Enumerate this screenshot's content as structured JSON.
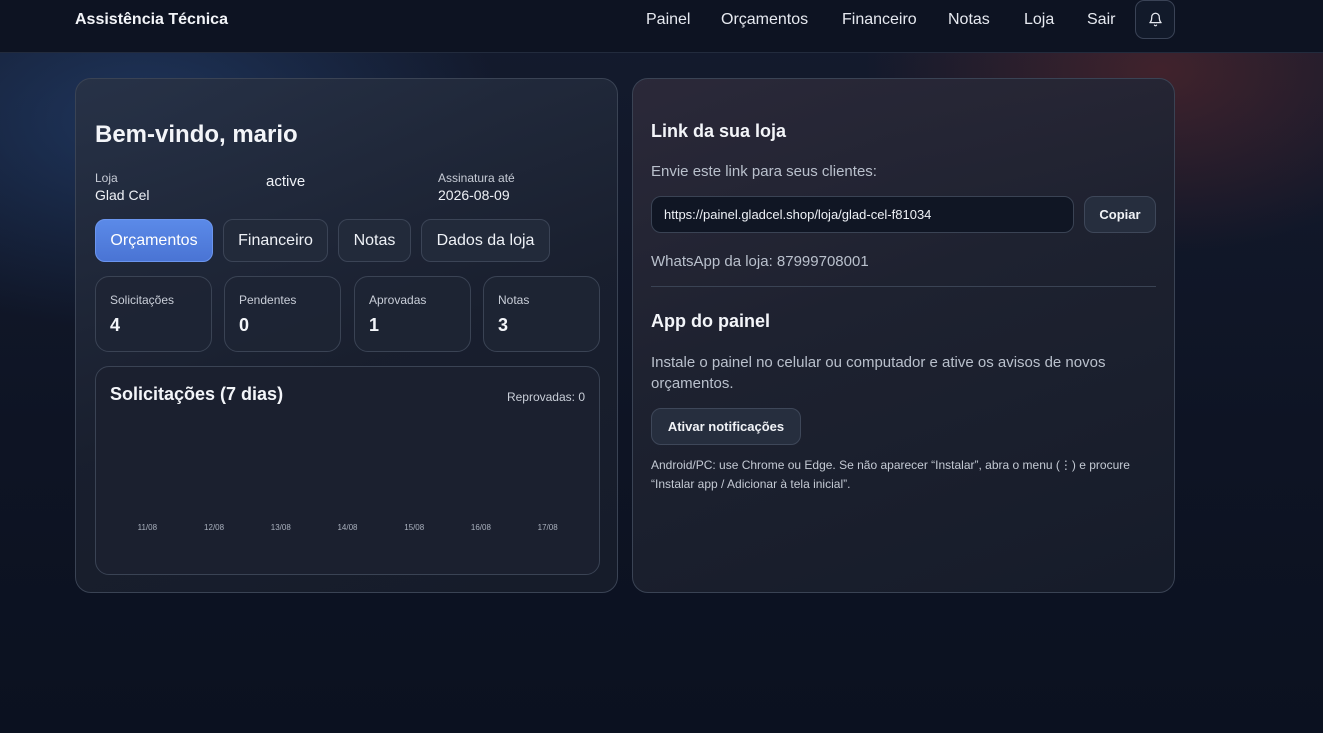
{
  "nav": {
    "brand": "Assistência Técnica",
    "links": [
      "Painel",
      "Orçamentos",
      "Financeiro",
      "Notas",
      "Loja",
      "Sair"
    ],
    "bell_icon": "bell-icon"
  },
  "left": {
    "welcome": "Bem-vindo, mario",
    "store_label": "Loja",
    "store_value": "Glad Cel",
    "status": "active",
    "subscription_label": "Assinatura até",
    "subscription_value": "2026-08-09",
    "tabs": [
      "Orçamentos",
      "Financeiro",
      "Notas",
      "Dados da loja"
    ],
    "stats": [
      {
        "label": "Solicitações",
        "value": "4"
      },
      {
        "label": "Pendentes",
        "value": "0"
      },
      {
        "label": "Aprovadas",
        "value": "1"
      },
      {
        "label": "Notas",
        "value": "3"
      }
    ]
  },
  "chart_data": {
    "type": "bar",
    "title": "Solicitações (7 dias)",
    "note": "Reprovadas: 0",
    "categories": [
      "11/08",
      "12/08",
      "13/08",
      "14/08",
      "15/08",
      "16/08",
      "17/08"
    ],
    "values": [
      0,
      0,
      0,
      0,
      0,
      0,
      0
    ],
    "xlabel": "",
    "ylabel": ""
  },
  "right": {
    "link_heading": "Link da sua loja",
    "link_description": "Envie este link para seus clientes:",
    "link_url": "https://painel.gladcel.shop/loja/glad-cel-f81034",
    "copy_button": "Copiar",
    "whatsapp": "WhatsApp da loja: 87999708001",
    "app_heading": "App do painel",
    "app_description_line1": "Instale o painel no celular ou computador e ative os avisos de novos",
    "app_description_line2": "orçamentos.",
    "notify_button": "Ativar notificações",
    "hint_line1": "Android/PC: use Chrome ou Edge. Se não aparecer “Instalar”, abra o menu (⋮) e procure",
    "hint_line2": "“Instalar app / Adicionar à tela inicial”."
  },
  "colors": {
    "accent": "#5b8ae8",
    "background": "#0e1424",
    "card_border": "#3a4354"
  }
}
